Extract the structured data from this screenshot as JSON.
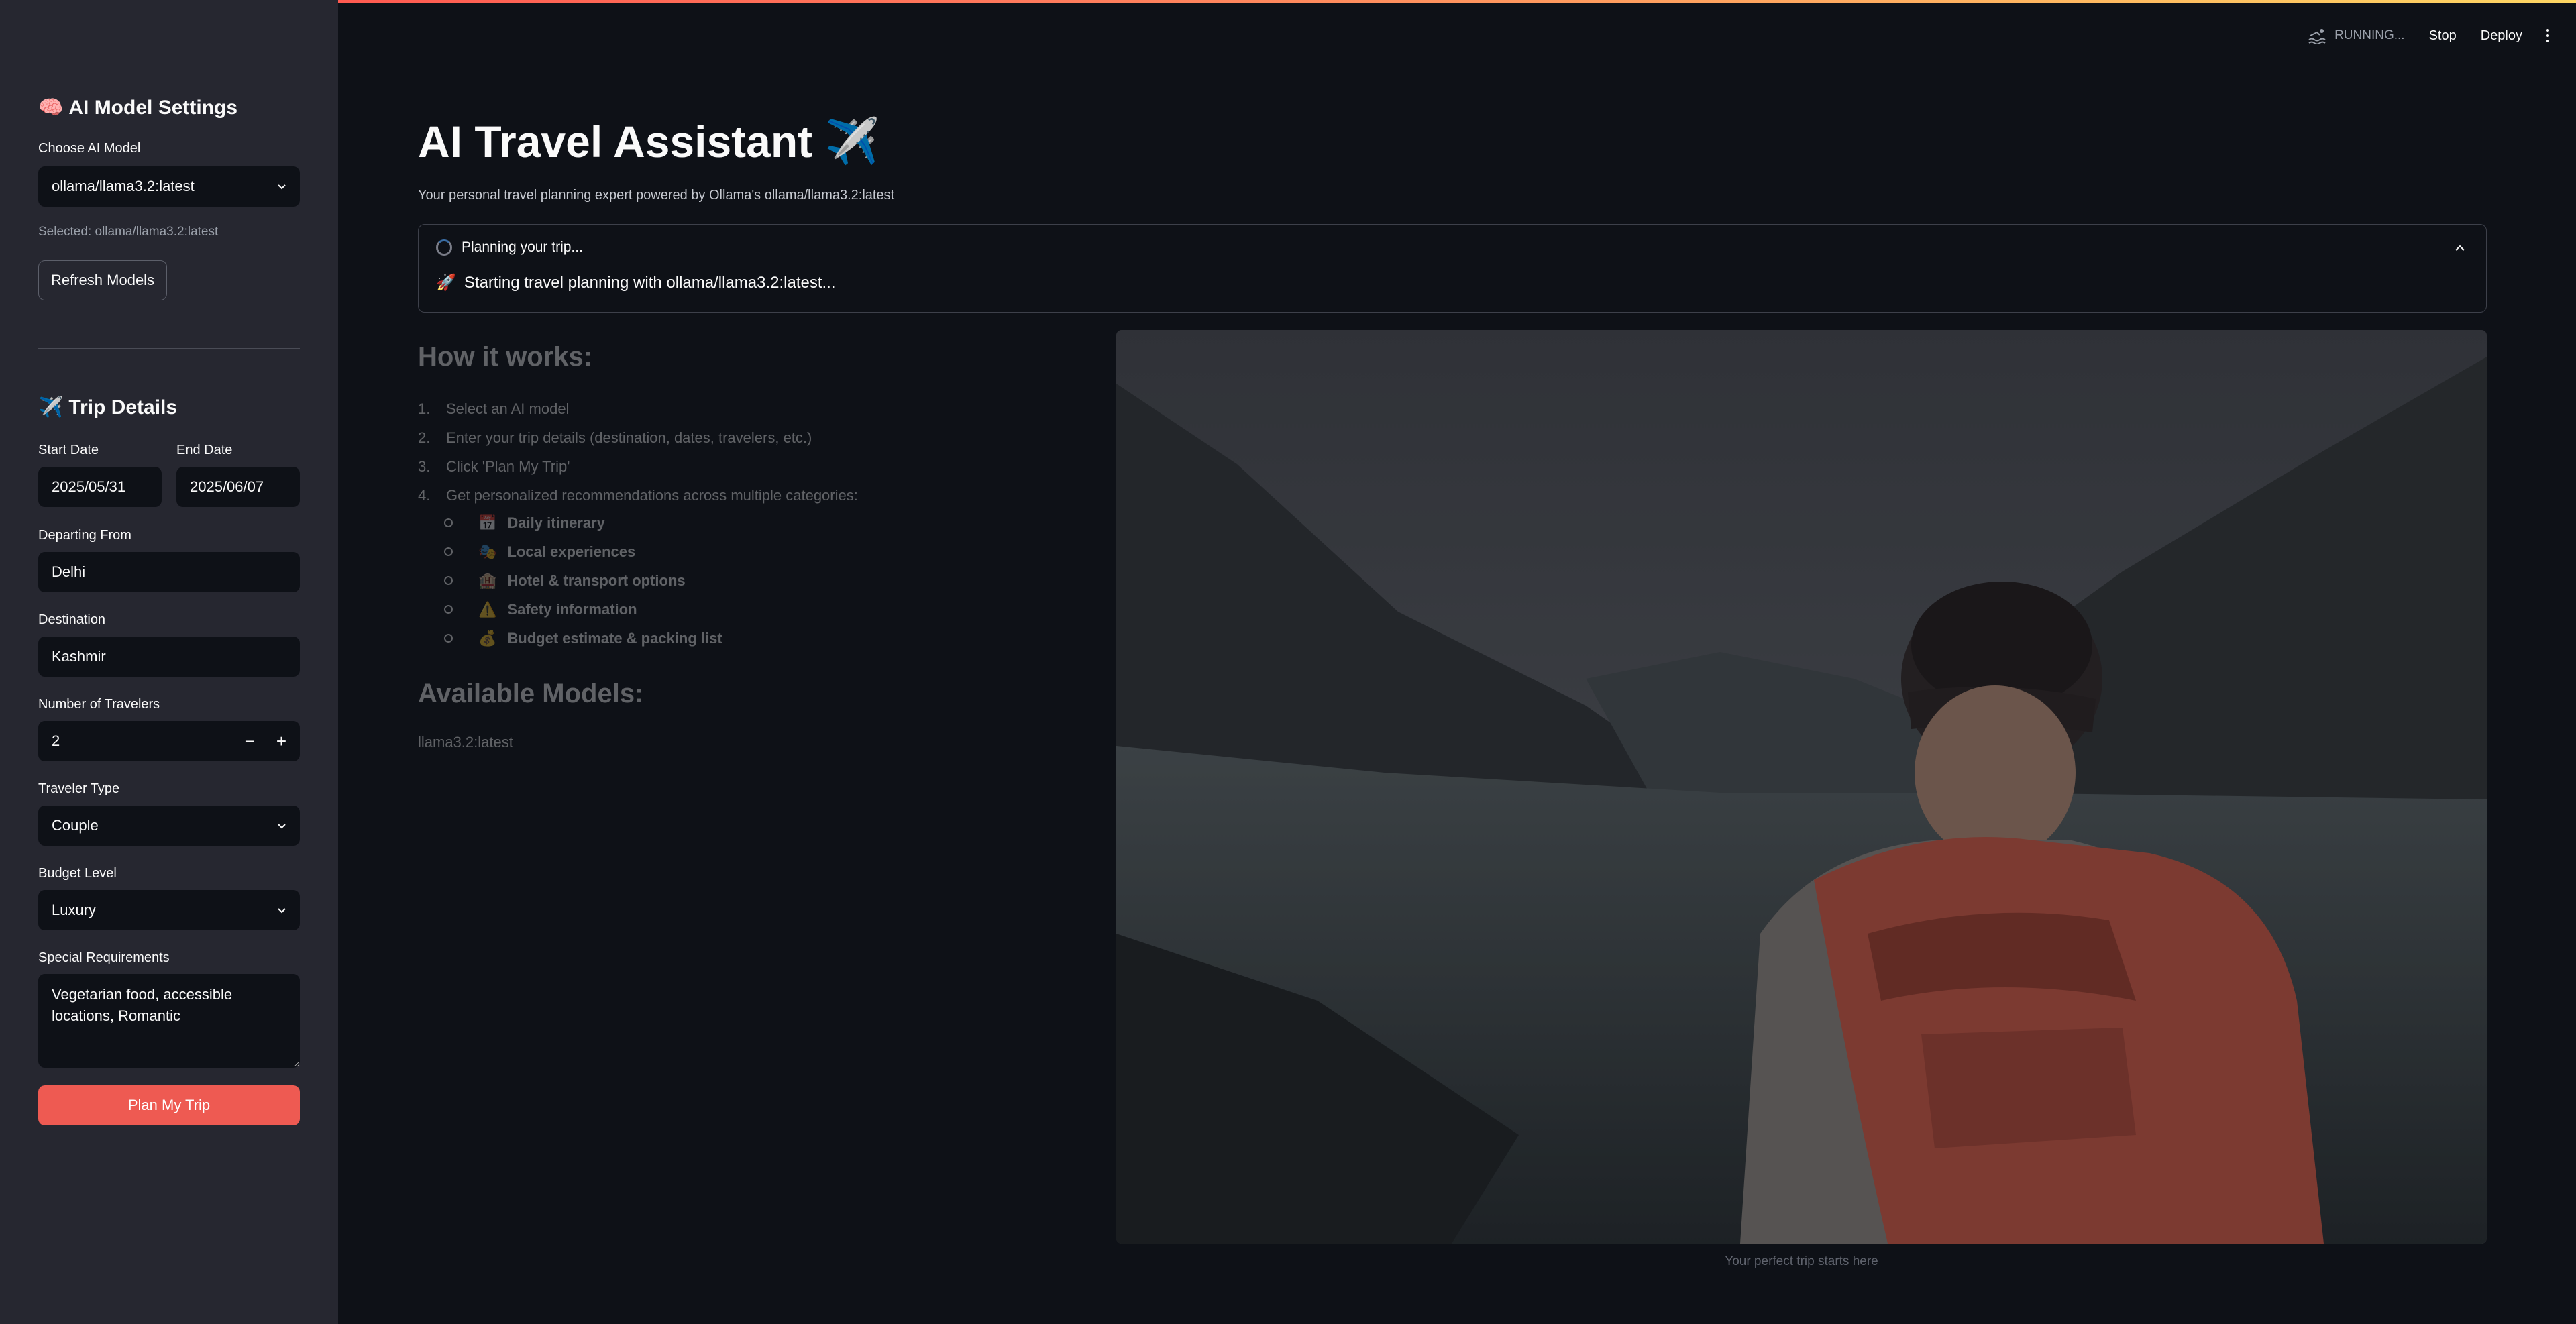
{
  "header": {
    "running_label": "RUNNING...",
    "stop_label": "Stop",
    "deploy_label": "Deploy"
  },
  "sidebar": {
    "model_settings_heading": "AI Model Settings",
    "choose_model_label": "Choose AI Model",
    "model_selected_value": "ollama/llama3.2:latest",
    "selected_caption": "Selected: ollama/llama3.2:latest",
    "refresh_button": "Refresh Models",
    "trip_details_heading": "Trip Details",
    "start_date_label": "Start Date",
    "start_date_value": "2025/05/31",
    "end_date_label": "End Date",
    "end_date_value": "2025/06/07",
    "departing_label": "Departing From",
    "departing_value": "Delhi",
    "destination_label": "Destination",
    "destination_value": "Kashmir",
    "travelers_label": "Number of Travelers",
    "travelers_value": "2",
    "traveler_type_label": "Traveler Type",
    "traveler_type_value": "Couple",
    "budget_label": "Budget Level",
    "budget_value": "Luxury",
    "special_label": "Special Requirements",
    "special_value": "Vegetarian food, accessible locations, Romantic",
    "plan_button": "Plan My Trip"
  },
  "main": {
    "title": "AI Travel Assistant",
    "subtitle": "Your personal travel planning expert powered by Ollama's ollama/llama3.2:latest",
    "status": {
      "heading": "Planning your trip...",
      "message": "Starting travel planning with ollama/llama3.2:latest..."
    },
    "how_it_works_heading": "How it works:",
    "steps": [
      {
        "num": "1.",
        "text": "Select an AI model"
      },
      {
        "num": "2.",
        "text": "Enter your trip details (destination, dates, travelers, etc.)"
      },
      {
        "num": "3.",
        "text": "Click 'Plan My Trip'"
      },
      {
        "num": "4.",
        "text": "Get personalized recommendations across multiple categories:"
      }
    ],
    "categories": [
      {
        "icon": "📅",
        "text": "Daily itinerary"
      },
      {
        "icon": "🎭",
        "text": "Local experiences"
      },
      {
        "icon": "🏨",
        "text": "Hotel & transport options"
      },
      {
        "icon": "⚠️",
        "text": "Safety information"
      },
      {
        "icon": "💰",
        "text": "Budget estimate & packing list"
      }
    ],
    "available_models_heading": "Available Models:",
    "available_model": "llama3.2:latest",
    "hero_caption": "Your perfect trip starts here"
  },
  "icons": {
    "brain": "🧠",
    "plane": "✈️",
    "rocket": "🚀"
  }
}
